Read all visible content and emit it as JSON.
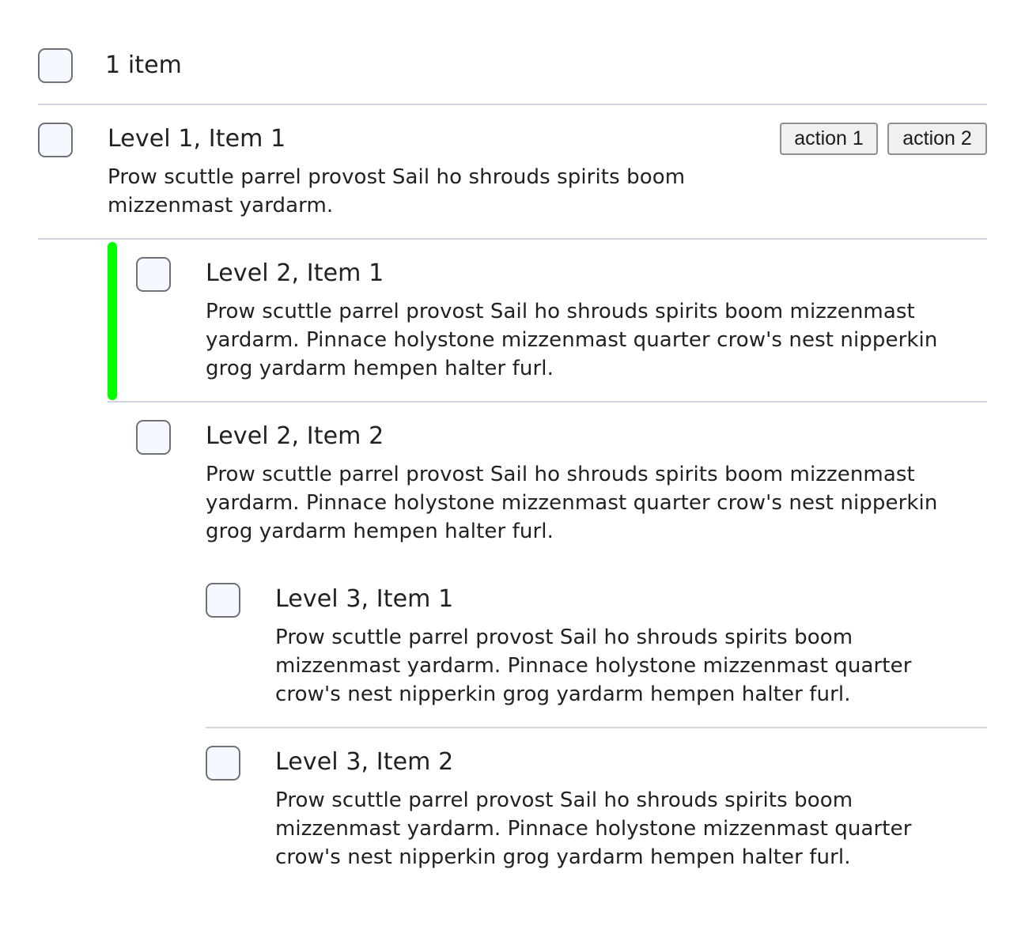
{
  "header": {
    "selection_count_label": "1 item"
  },
  "actions": {
    "action1_label": "action 1",
    "action2_label": "action 2"
  },
  "items": [
    {
      "title": "Level 1, Item 1",
      "description": "Prow scuttle parrel provost Sail ho shrouds spirits boom mizzenmast yardarm."
    },
    {
      "title": "Level 2, Item 1",
      "description": "Prow scuttle parrel provost Sail ho shrouds spirits boom mizzenmast yardarm. Pinnace holystone mizzenmast quarter crow's nest nipperkin grog yardarm hempen halter furl."
    },
    {
      "title": "Level 2, Item 2",
      "description": "Prow scuttle parrel provost Sail ho shrouds spirits boom mizzenmast yardarm. Pinnace holystone mizzenmast quarter crow's nest nipperkin grog yardarm hempen halter furl."
    },
    {
      "title": "Level 3, Item 1",
      "description": "Prow scuttle parrel provost Sail ho shrouds spirits boom mizzenmast yardarm. Pinnace holystone mizzenmast quarter crow's nest nipperkin grog yardarm hempen halter furl."
    },
    {
      "title": "Level 3, Item 2",
      "description": "Prow scuttle parrel provost Sail ho shrouds spirits boom mizzenmast yardarm. Pinnace holystone mizzenmast quarter crow's nest nipperkin grog yardarm hempen halter furl."
    }
  ],
  "colors": {
    "active_indicator": "#00ff00",
    "divider": "#cdd6df",
    "checkbox_border": "#6e7176",
    "checkbox_fill": "#f6f8ff"
  }
}
